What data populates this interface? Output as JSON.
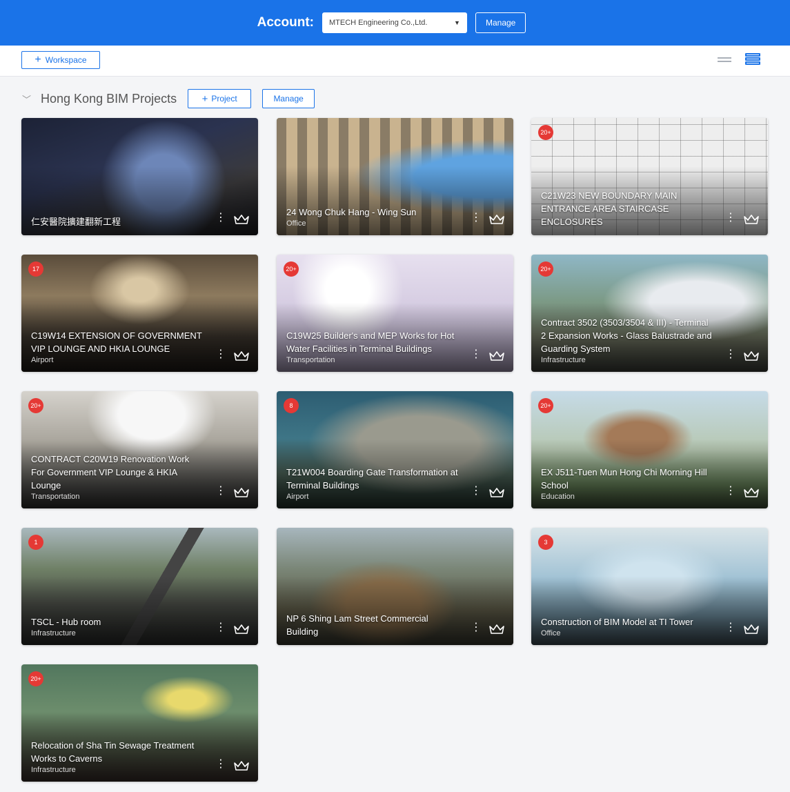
{
  "header": {
    "account_label": "Account:",
    "account_value": "MTECH Engineering Co.,Ltd.",
    "manage_label": "Manage"
  },
  "toolbar": {
    "workspace_label": "Workspace"
  },
  "section": {
    "title": "Hong Kong BIM Projects",
    "project_label": "Project",
    "manage_label": "Manage"
  },
  "colors": {
    "brand": "#1a73e8",
    "badge": "#e53935"
  },
  "projects": [
    {
      "title": "仁安醫院擴建翻新工程",
      "category": "",
      "badge": ""
    },
    {
      "title": "24 Wong Chuk Hang - Wing Sun",
      "category": "Office",
      "badge": ""
    },
    {
      "title": "C21W23 NEW BOUNDARY MAIN ENTRANCE AREA STAIRCASE ENCLOSURES",
      "category": "",
      "badge": "20+"
    },
    {
      "title": "C19W14 EXTENSION OF GOVERNMENT VIP LOUNGE AND HKIA LOUNGE",
      "category": "Airport",
      "badge": "17"
    },
    {
      "title": "C19W25 Builder's and MEP Works for Hot Water Facilities in Terminal Buildings",
      "category": "Transportation",
      "badge": "20+"
    },
    {
      "title": "Contract 3502 (3503/3504 & III) - Terminal 2 Expansion Works - Glass Balustrade and Guarding System",
      "category": "Infrastructure",
      "badge": "20+"
    },
    {
      "title": "CONTRACT C20W19 Renovation Work For Government VIP Lounge & HKIA Lounge",
      "category": "Transportation",
      "badge": "20+"
    },
    {
      "title": "T21W004 Boarding Gate Transformation at Terminal Buildings",
      "category": "Airport",
      "badge": "8"
    },
    {
      "title": "EX J511-Tuen Mun Hong Chi Morning Hill School",
      "category": "Education",
      "badge": "20+"
    },
    {
      "title": "TSCL - Hub room",
      "category": "Infrastructure",
      "badge": "1"
    },
    {
      "title": "NP 6 Shing Lam Street Commercial Building",
      "category": "",
      "badge": ""
    },
    {
      "title": "Construction of BIM Model at TI Tower",
      "category": "Office",
      "badge": "3"
    },
    {
      "title": "Relocation of Sha Tin Sewage Treatment Works to Caverns",
      "category": "Infrastructure",
      "badge": "20+"
    }
  ]
}
